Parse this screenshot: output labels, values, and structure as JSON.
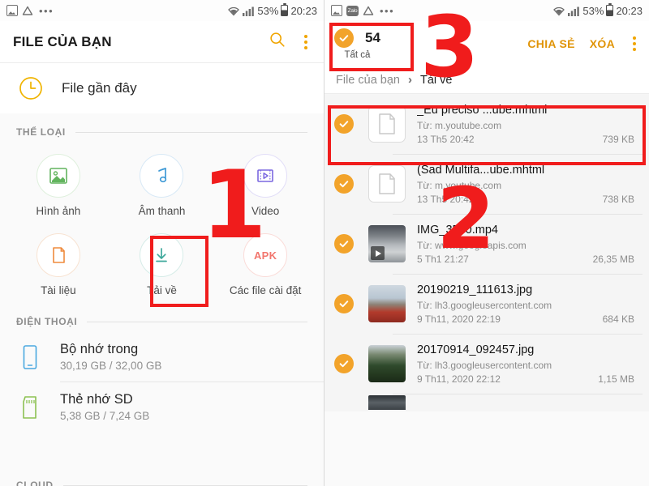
{
  "status_bar": {
    "icons": [
      "photo-icon",
      "zalo-icon",
      "drive-icon",
      "overflow-dots-icon"
    ],
    "zalo_label": "Zalo",
    "battery_percent": "53%",
    "time": "20:23"
  },
  "left_panel": {
    "app_title": "FILE CỦA BẠN",
    "search_icon": "search-icon",
    "menu_icon": "kebab-menu-icon",
    "recent": {
      "label": "File gần đây",
      "icon": "clock-icon"
    },
    "categories_section": {
      "title": "THỂ LOẠI"
    },
    "categories": [
      {
        "label": "Hình ảnh",
        "icon": "image-icon",
        "color": "#62b45e"
      },
      {
        "label": "Âm thanh",
        "icon": "music-note-icon",
        "color": "#3f9ad6"
      },
      {
        "label": "Video",
        "icon": "video-icon",
        "color": "#7b68e0"
      },
      {
        "label": "Tài liệu",
        "icon": "document-icon",
        "color": "#ef8b3d"
      },
      {
        "label": "Tải về",
        "icon": "download-icon",
        "color": "#3ea89b"
      },
      {
        "label": "Các file cài đặt",
        "icon": "apk-icon",
        "color": "#f2766e",
        "text": "APK"
      }
    ],
    "phone_section": {
      "title": "ĐIỆN THOẠI"
    },
    "storage": [
      {
        "name": "Bộ nhớ trong",
        "usage": "30,19 GB / 32,00 GB",
        "icon": "phone-icon",
        "color": "#4aa8e0"
      },
      {
        "name": "Thẻ nhớ SD",
        "usage": "5,38 GB / 7,24 GB",
        "icon": "sd-card-icon",
        "color": "#8cc152"
      }
    ],
    "cloud_section": {
      "title": "CLOUD"
    }
  },
  "right_panel": {
    "select_all": {
      "label": "Tất cả",
      "count": "54",
      "checked": true
    },
    "actions": {
      "share": "CHIA SẺ",
      "delete": "XÓA",
      "menu_icon": "kebab-menu-icon"
    },
    "breadcrumb": {
      "root": "File của bạn",
      "separator": "›",
      "current": "Tải về"
    },
    "files": [
      {
        "name": "_Eu preciso ...ube.mhtml",
        "source": "Từ: m.youtube.com",
        "date": "13 Th5 20:42",
        "size": "739 KB",
        "thumb": "document",
        "selected": true
      },
      {
        "name": "(Sad Multifa...ube.mhtml",
        "source": "Từ: m.youtube.com",
        "date": "13 Th5 20:42",
        "size": "738 KB",
        "thumb": "document",
        "selected": true
      },
      {
        "name": "IMG_3530.mp4",
        "source": "Từ: www.googleapis.com",
        "date": "5 Th1 21:27",
        "size": "26,35 MB",
        "thumb": "video-sky",
        "selected": true
      },
      {
        "name": "20190219_111613.jpg",
        "source": "Từ: lh3.googleusercontent.com",
        "date": "9 Th11, 2020 22:19",
        "size": "684 KB",
        "thumb": "photo-girl",
        "selected": true
      },
      {
        "name": "20170914_092457.jpg",
        "source": "Từ: lh3.googleusercontent.com",
        "date": "9 Th11, 2020 22:12",
        "size": "1,15 MB",
        "thumb": "photo-crowd",
        "selected": true
      }
    ]
  },
  "annotations": {
    "step_1": "1",
    "step_2": "2",
    "step_3": "3",
    "color": "#f01c1c"
  }
}
